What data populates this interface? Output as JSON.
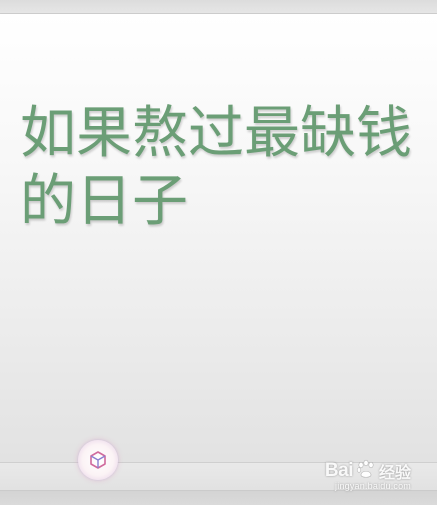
{
  "slide": {
    "title": "如果熬过最缺钱的日子"
  },
  "colors": {
    "title_text": "#6b9e76",
    "background": "#e3e3e3",
    "badge_accent": "#d06a9c"
  },
  "app_badge": {
    "icon": "cube-icon"
  },
  "watermark": {
    "brand_left": "Bai",
    "brand_icon": "paw-icon",
    "brand_right": "经验",
    "url": "jingyan.baidu.com"
  }
}
